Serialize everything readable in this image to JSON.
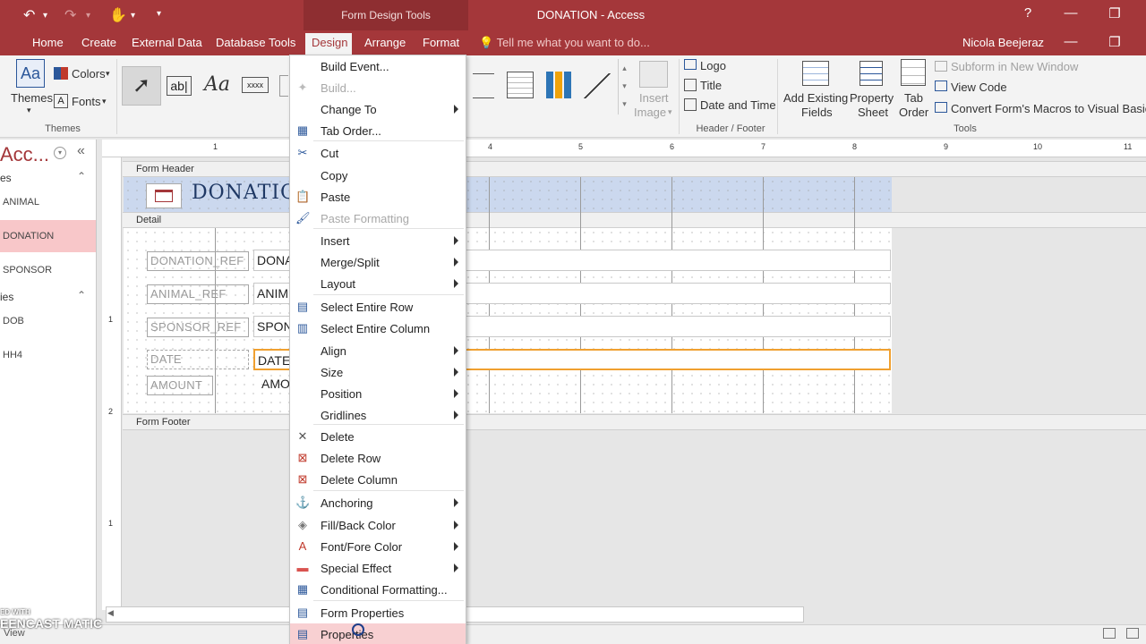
{
  "titlebar": {
    "context_title": "Form Design Tools",
    "app_title": "DONATION - Access",
    "help": "?"
  },
  "tabs": [
    "Home",
    "Create",
    "External Data",
    "Database Tools",
    "Design",
    "Arrange",
    "Format"
  ],
  "tell_me": "Tell me what you want to do...",
  "user": "Nicola Beejeraz",
  "ribbon": {
    "themes_label": "Themes",
    "colors_label": "Colors",
    "fonts_label": "Fonts",
    "themes_group": "Themes",
    "insert_image": "Insert",
    "insert_image2": "Image",
    "logo": "Logo",
    "title": "Title",
    "date_time": "Date and Time",
    "header_footer_group": "Header / Footer",
    "add_fields_1": "Add Existing",
    "add_fields_2": "Fields",
    "property_sheet_1": "Property",
    "property_sheet_2": "Sheet",
    "tab_order_1": "Tab",
    "tab_order_2": "Order",
    "subform_new_window": "Subform in New Window",
    "view_code": "View Code",
    "convert_macros": "Convert Form's Macros to Visual Basic",
    "tools_group": "Tools"
  },
  "nav": {
    "title": "Acc...",
    "section1": "es",
    "items1": [
      "ANIMAL",
      "DONATION",
      "SPONSOR"
    ],
    "section2": "ies",
    "items2": [
      "DOB",
      "HH4"
    ]
  },
  "form": {
    "header_section": "Form Header",
    "detail_section": "Detail",
    "footer_section": "Form Footer",
    "title": "DONATIO",
    "labels": [
      "DONATION_REF",
      "ANIMAL_REF",
      "SPONSOR_REF",
      "DATE",
      "AMOUNT"
    ],
    "boxes": [
      "DONA",
      "ANIM",
      "SPON",
      "DATE",
      "AMO"
    ]
  },
  "ruler": {
    "top_numbers": [
      "1",
      "4",
      "5",
      "6",
      "7",
      "8",
      "9",
      "10",
      "11"
    ],
    "left_numbers": [
      "1",
      "2",
      "1"
    ]
  },
  "context_menu": {
    "items": [
      {
        "label": "Build Event...",
        "icon": "none",
        "submenu": false,
        "disabled": false
      },
      {
        "label": "Build...",
        "icon": "wand-icon",
        "submenu": false,
        "disabled": true
      },
      {
        "label": "Change To",
        "icon": "none",
        "submenu": true,
        "disabled": false
      },
      {
        "label": "Tab Order...",
        "icon": "tab-order-icon",
        "submenu": false,
        "disabled": false
      },
      {
        "label": "Cut",
        "icon": "scissors-icon",
        "submenu": false,
        "disabled": false
      },
      {
        "label": "Copy",
        "icon": "none",
        "submenu": false,
        "disabled": false
      },
      {
        "label": "Paste",
        "icon": "clipboard-icon",
        "submenu": false,
        "disabled": false
      },
      {
        "label": "Paste Formatting",
        "icon": "paste-format-icon",
        "submenu": false,
        "disabled": true
      },
      {
        "label": "Insert",
        "icon": "none",
        "submenu": true,
        "disabled": false
      },
      {
        "label": "Merge/Split",
        "icon": "none",
        "submenu": true,
        "disabled": false
      },
      {
        "label": "Layout",
        "icon": "none",
        "submenu": true,
        "disabled": false
      },
      {
        "label": "Select Entire Row",
        "icon": "table-row-icon",
        "submenu": false,
        "disabled": false
      },
      {
        "label": "Select Entire Column",
        "icon": "table-column-icon",
        "submenu": false,
        "disabled": false
      },
      {
        "label": "Align",
        "icon": "none",
        "submenu": true,
        "disabled": false
      },
      {
        "label": "Size",
        "icon": "none",
        "submenu": true,
        "disabled": false
      },
      {
        "label": "Position",
        "icon": "none",
        "submenu": true,
        "disabled": false
      },
      {
        "label": "Gridlines",
        "icon": "none",
        "submenu": true,
        "disabled": false
      },
      {
        "label": "Delete",
        "icon": "x-icon",
        "submenu": false,
        "disabled": false
      },
      {
        "label": "Delete Row",
        "icon": "delete-row-icon",
        "submenu": false,
        "disabled": false
      },
      {
        "label": "Delete Column",
        "icon": "delete-column-icon",
        "submenu": false,
        "disabled": false
      },
      {
        "label": "Anchoring",
        "icon": "anchor-icon",
        "submenu": true,
        "disabled": false
      },
      {
        "label": "Fill/Back Color",
        "icon": "paint-bucket-icon",
        "submenu": true,
        "disabled": false
      },
      {
        "label": "Font/Fore Color",
        "icon": "font-color-icon",
        "submenu": true,
        "disabled": false
      },
      {
        "label": "Special Effect",
        "icon": "special-effect-icon",
        "submenu": true,
        "disabled": false
      },
      {
        "label": "Conditional Formatting...",
        "icon": "conditional-format-icon",
        "submenu": false,
        "disabled": false
      },
      {
        "label": "Form Properties",
        "icon": "form-properties-icon",
        "submenu": false,
        "disabled": false
      },
      {
        "label": "Properties",
        "icon": "properties-icon",
        "submenu": false,
        "disabled": false,
        "highlighted": true
      }
    ]
  },
  "status": {
    "view": "View"
  },
  "watermark": {
    "line1": "ED WITH",
    "line2": "EENCAST MATIC"
  },
  "colors": {
    "accent": "#a4373a",
    "highlight": "#f8d0d2",
    "selected_nav": "#f8c7c9"
  }
}
